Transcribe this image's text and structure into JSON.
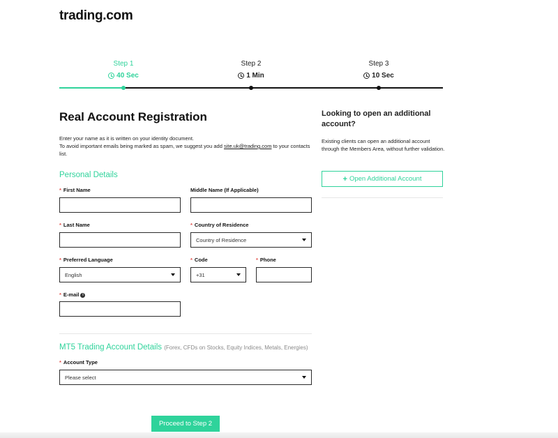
{
  "brand": {
    "logo_text": "trading.com",
    "accent": "#2fd39b",
    "error_star": "#e2504a"
  },
  "stepper": {
    "steps": [
      {
        "label": "Step 1",
        "time": "40 Sec",
        "active": true
      },
      {
        "label": "Step 2",
        "time": "1 Min",
        "active": false
      },
      {
        "label": "Step 3",
        "time": "10 Sec",
        "active": false
      }
    ],
    "icon": "clock-icon"
  },
  "form": {
    "title": "Real Account Registration",
    "intro_line1": "Enter your name as it is written on your identity document.",
    "intro_line2_pre": "To avoid important emails being marked as spam, we suggest you add ",
    "intro_link": "site.uk@trading.com",
    "intro_line2_post": " to your contacts list.",
    "personal_section": "Personal Details",
    "required_mark": "*",
    "fields": {
      "first_name": {
        "label": "First Name",
        "value": ""
      },
      "middle_name": {
        "label": "Middle Name (If Applicable)",
        "value": ""
      },
      "last_name": {
        "label": "Last Name",
        "value": ""
      },
      "country": {
        "label": "Country of Residence",
        "selected": "Country of Residence"
      },
      "language": {
        "label": "Preferred Language",
        "selected": "English"
      },
      "code": {
        "label": "Code",
        "selected": "+31"
      },
      "phone": {
        "label": "Phone",
        "value": ""
      },
      "email": {
        "label": "E-mail",
        "value": ""
      },
      "account_type": {
        "label": "Account Type",
        "selected": "Please select"
      }
    },
    "info_glyph": "i",
    "mt5_section": "MT5 Trading Account Details",
    "mt5_section_sub": "(Forex, CFDs on Stocks, Equity Indices, Metals, Energies)",
    "proceed_label": "Proceed to Step 2"
  },
  "aside": {
    "title": "Looking to open an additional account?",
    "text": "Existing clients can open an additional account through the Members Area, without further validation.",
    "plus_glyph": "+",
    "button_label": "Open Additional Account"
  }
}
